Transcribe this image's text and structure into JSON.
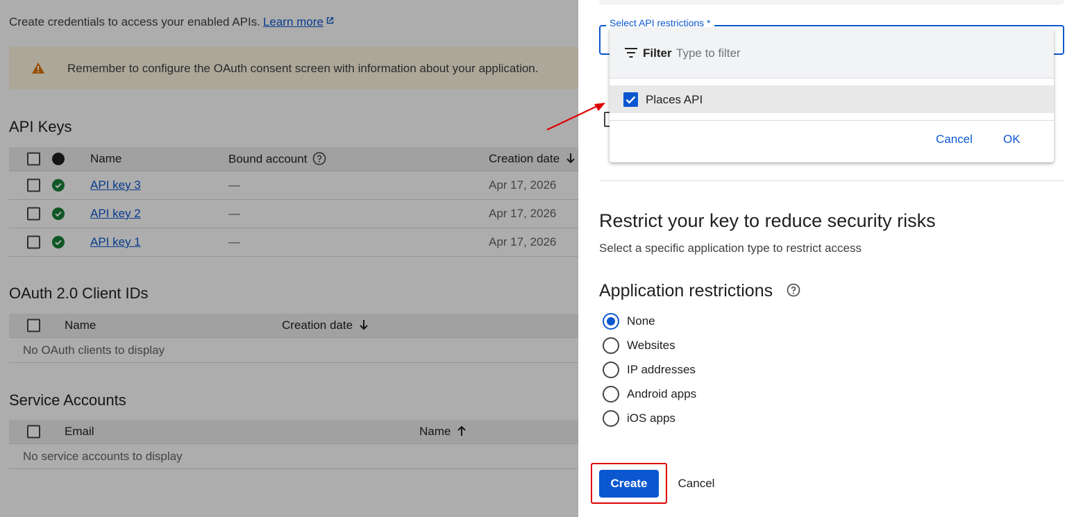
{
  "intro": {
    "text": "Create credentials to access your enabled APIs.",
    "learn_more": "Learn more"
  },
  "banner": {
    "text": "Remember to configure the OAuth consent screen with information about your application."
  },
  "api_keys": {
    "title": "API Keys",
    "headers": {
      "name": "Name",
      "bound_account": "Bound account",
      "creation_date": "Creation date"
    },
    "rows": [
      {
        "name": "API key 3",
        "bound": "—",
        "date": "Apr 17, 2026"
      },
      {
        "name": "API key 2",
        "bound": "—",
        "date": "Apr 17, 2026"
      },
      {
        "name": "API key 1",
        "bound": "—",
        "date": "Apr 17, 2026"
      }
    ]
  },
  "oauth": {
    "title": "OAuth 2.0 Client IDs",
    "headers": {
      "name": "Name",
      "creation_date": "Creation date"
    },
    "empty": "No OAuth clients to display"
  },
  "service_accounts": {
    "title": "Service Accounts",
    "headers": {
      "email": "Email",
      "name": "Name"
    },
    "empty": "No service accounts to display"
  },
  "panel": {
    "api_restrictions_label": "Select API restrictions *",
    "restrict_heading": "Restrict your key to reduce security risks",
    "restrict_sub": "Select a specific application type to restrict access",
    "app_restrictions_heading": "Application restrictions",
    "radio_options": [
      "None",
      "Websites",
      "IP addresses",
      "Android apps",
      "iOS apps"
    ],
    "selected_radio": "None",
    "create_label": "Create",
    "cancel_label": "Cancel"
  },
  "dropdown": {
    "filter_label": "Filter",
    "filter_placeholder": "Type to filter",
    "option_label": "Places API",
    "option_checked": true,
    "cancel_label": "Cancel",
    "ok_label": "OK"
  },
  "colors": {
    "primary": "#0b57d0",
    "success": "#188038",
    "warning": "#e37400",
    "annotation": "#e00000"
  }
}
